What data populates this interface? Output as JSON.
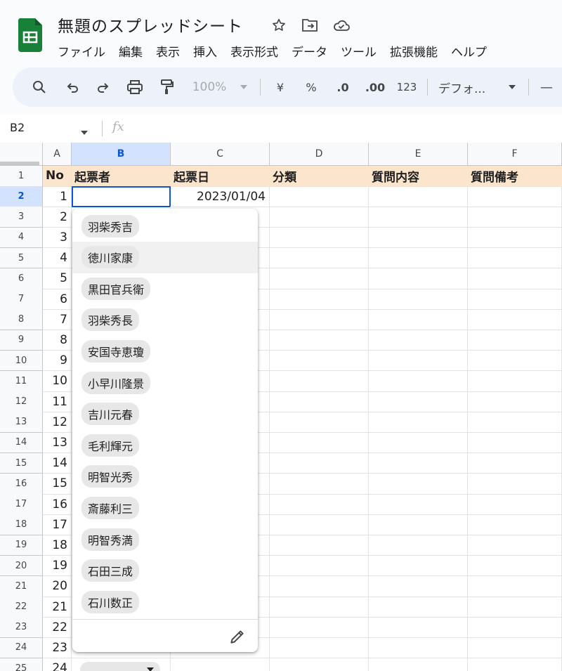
{
  "doc_title": "無題のスプレッドシート",
  "menu": [
    "ファイル",
    "編集",
    "表示",
    "挿入",
    "表示形式",
    "データ",
    "ツール",
    "拡張機能",
    "ヘルプ"
  ],
  "toolbar": {
    "zoom": "100%",
    "currency": "¥",
    "percent": "%",
    "dec_decrease": ".0",
    "dec_increase": ".00",
    "number_format": "123",
    "font": "デフォ...",
    "minus": "—"
  },
  "formula_bar": {
    "name_box": "B2",
    "fx_label": "fx"
  },
  "columns": [
    "A",
    "B",
    "C",
    "D",
    "E",
    "F"
  ],
  "rows": [
    "1",
    "2",
    "3",
    "4",
    "5",
    "6",
    "7",
    "8",
    "9",
    "10",
    "11",
    "12",
    "13",
    "14",
    "15",
    "16",
    "17",
    "18",
    "19",
    "20",
    "21",
    "22",
    "23",
    "24",
    "25"
  ],
  "header_row": [
    "No",
    "起票者",
    "起票日",
    "分類",
    "質問内容",
    "質問備考"
  ],
  "col_a_values": [
    "1",
    "2",
    "3",
    "4",
    "5",
    "6",
    "7",
    "8",
    "9",
    "10",
    "11",
    "12",
    "13",
    "14",
    "15",
    "16",
    "17",
    "18",
    "19",
    "20",
    "21",
    "22",
    "23",
    "24"
  ],
  "c2_value": "2023/01/04",
  "dropdown_options": [
    "羽柴秀吉",
    "徳川家康",
    "黒田官兵衛",
    "羽柴秀長",
    "安国寺恵瓊",
    "小早川隆景",
    "吉川元春",
    "毛利輝元",
    "明智光秀",
    "斎藤利三",
    "明智秀満",
    "石田三成",
    "石川数正"
  ],
  "highlighted_option_index": 1,
  "colors": {
    "header_fill": "#fce5cd",
    "accent": "#0b57d0",
    "logo": "#188038"
  }
}
